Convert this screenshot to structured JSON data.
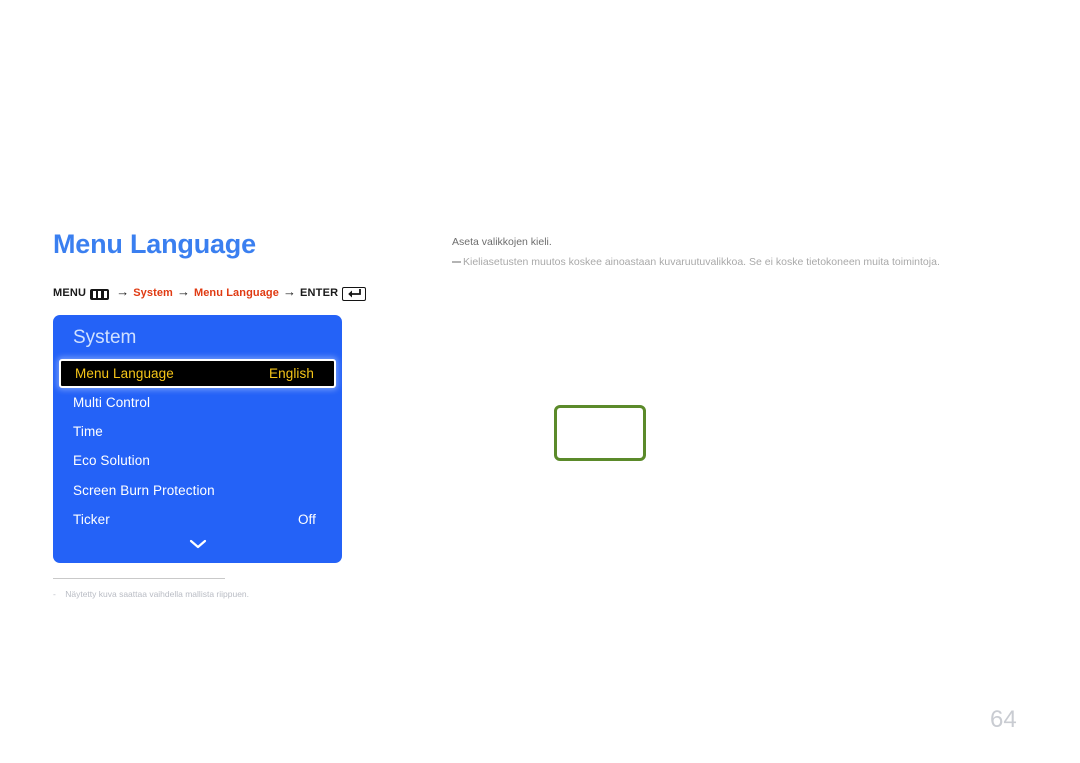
{
  "page": {
    "title": "Menu Language",
    "number": "64"
  },
  "breadcrumb": {
    "menu_label": "MENU",
    "menu_icon": "menu-bars-icon",
    "arrow": "→",
    "step1": "System",
    "step2": "Menu Language",
    "enter_label": "ENTER",
    "enter_icon": "enter-return-icon"
  },
  "osd": {
    "title": "System",
    "chevron_icon": "chevron-down-icon",
    "rows": [
      {
        "label": "Menu Language",
        "value": "English",
        "selected": true
      },
      {
        "label": "Multi Control",
        "value": "",
        "selected": false
      },
      {
        "label": "Time",
        "value": "",
        "selected": false
      },
      {
        "label": "Eco Solution",
        "value": "",
        "selected": false
      },
      {
        "label": "Screen Burn Protection",
        "value": "",
        "selected": false
      },
      {
        "label": "Ticker",
        "value": "Off",
        "selected": false
      }
    ]
  },
  "description": {
    "main": "Aseta valikkojen kieli.",
    "note": "Kieliasetusten muutos koskee ainoastaan kuvaruutuvalikkoa. Se ei koske tietokoneen muita toimintoja."
  },
  "footnote": {
    "bullet": "-",
    "text": "Näytetty kuva saattaa vaihdella mallista riippuen."
  },
  "colors": {
    "heading_blue": "#3a7ff0",
    "osd_blue": "#2462f7",
    "osd_title_blue": "#cfe0ff",
    "selected_bg": "#000000",
    "selected_text": "#f5c518",
    "breadcrumb_red": "#e03a12",
    "green_box_border": "#5b8a2a",
    "page_number_grey": "#c9ccd2"
  }
}
